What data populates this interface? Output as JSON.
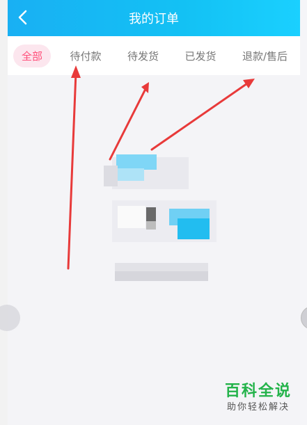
{
  "header": {
    "title": "我的订单"
  },
  "tabs": [
    {
      "label": "全部",
      "active": true
    },
    {
      "label": "待付款",
      "active": false
    },
    {
      "label": "待发货",
      "active": false
    },
    {
      "label": "已发货",
      "active": false
    },
    {
      "label": "退款/售后",
      "active": false
    }
  ],
  "colors": {
    "header": "#13c1f4",
    "active_tab": "#ff4f7a",
    "arrow": "#e83a3a",
    "watermark": "#23b34a"
  },
  "watermark": {
    "main": "百科全说",
    "sub": "助你轻松解决"
  }
}
